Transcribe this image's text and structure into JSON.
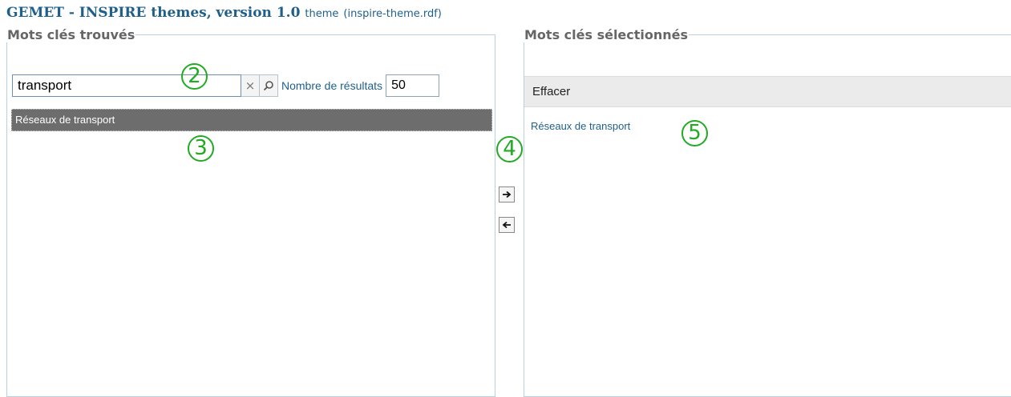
{
  "header": {
    "title": "GEMET - INSPIRE themes, version 1.0",
    "theme": "theme",
    "file": "(inspire-theme.rdf)"
  },
  "left_panel": {
    "legend": "Mots clés trouvés",
    "search": {
      "value": "transport"
    },
    "clear_symbol": "×",
    "results_label": "Nombre de résultats",
    "results_value": "50",
    "found_item": "Réseaux de transport"
  },
  "right_panel": {
    "legend": "Mots clés sélectionnés",
    "clear_label": "Effacer",
    "selected_item": "Réseaux de transport"
  },
  "markers": {
    "m2": "2",
    "m3": "3",
    "m4": "4",
    "m5": "5"
  },
  "icons": {
    "clear": "close-icon",
    "search": "search-icon",
    "add": "arrow-right-icon",
    "remove": "arrow-left-icon"
  },
  "colors": {
    "accent": "#1f5f8b",
    "marker": "#22aa22",
    "row_selected": "#6d6d6d"
  }
}
